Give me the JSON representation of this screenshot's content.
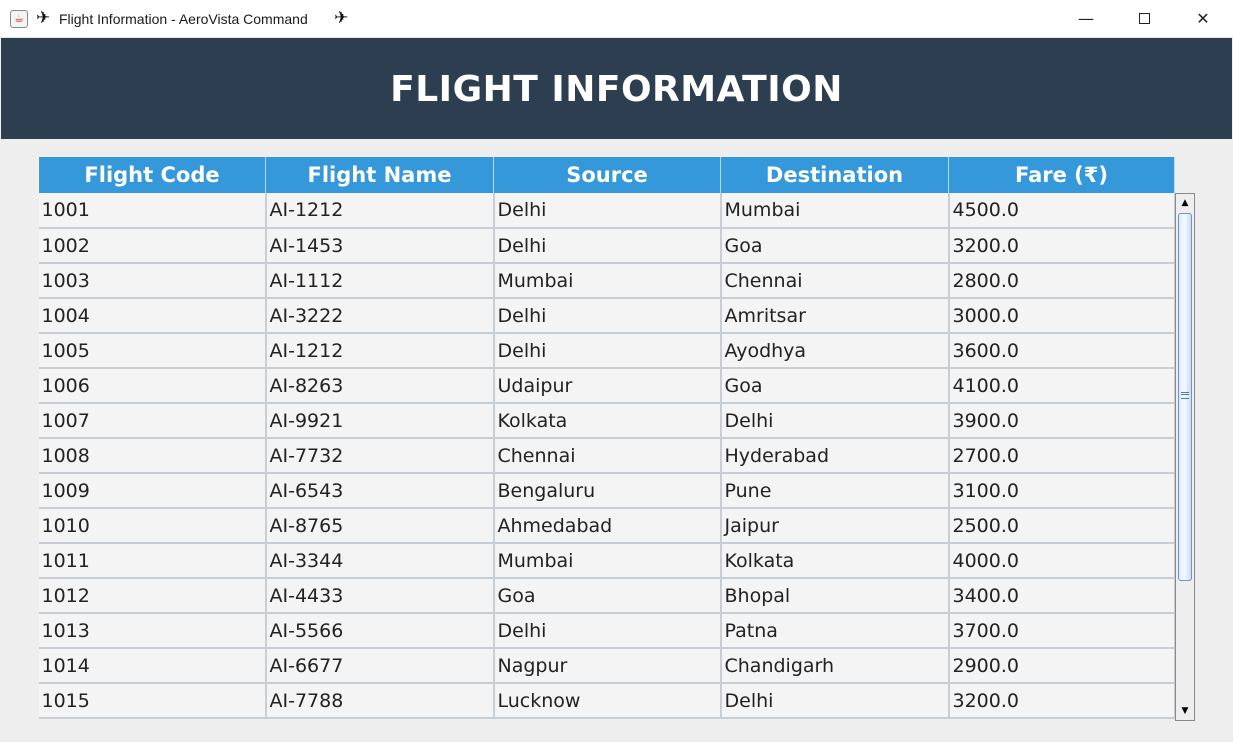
{
  "window": {
    "title": "Flight Information - AeroVista Command",
    "title_icon_left": "✈",
    "title_icon_right": "✈",
    "controls": {
      "minimize": "—",
      "close": "✕"
    }
  },
  "header": {
    "title": "FLIGHT INFORMATION"
  },
  "table": {
    "columns": [
      "Flight Code",
      "Flight Name",
      "Source",
      "Destination",
      "Fare (₹)"
    ],
    "rows": [
      [
        "1001",
        "AI-1212",
        "Delhi",
        "Mumbai",
        "4500.0"
      ],
      [
        "1002",
        "AI-1453",
        "Delhi",
        "Goa",
        "3200.0"
      ],
      [
        "1003",
        "AI-1112",
        "Mumbai",
        "Chennai",
        "2800.0"
      ],
      [
        "1004",
        "AI-3222",
        "Delhi",
        "Amritsar",
        "3000.0"
      ],
      [
        "1005",
        "AI-1212",
        "Delhi",
        "Ayodhya",
        "3600.0"
      ],
      [
        "1006",
        "AI-8263",
        "Udaipur",
        "Goa",
        "4100.0"
      ],
      [
        "1007",
        "AI-9921",
        "Kolkata",
        "Delhi",
        "3900.0"
      ],
      [
        "1008",
        "AI-7732",
        "Chennai",
        "Hyderabad",
        "2700.0"
      ],
      [
        "1009",
        "AI-6543",
        "Bengaluru",
        "Pune",
        "3100.0"
      ],
      [
        "1010",
        "AI-8765",
        "Ahmedabad",
        "Jaipur",
        "2500.0"
      ],
      [
        "1011",
        "AI-3344",
        "Mumbai",
        "Kolkata",
        "4000.0"
      ],
      [
        "1012",
        "AI-4433",
        "Goa",
        "Bhopal",
        "3400.0"
      ],
      [
        "1013",
        "AI-5566",
        "Delhi",
        "Patna",
        "3700.0"
      ],
      [
        "1014",
        "AI-6677",
        "Nagpur",
        "Chandigarh",
        "2900.0"
      ],
      [
        "1015",
        "AI-7788",
        "Lucknow",
        "Delhi",
        "3200.0"
      ]
    ]
  },
  "scrollbar": {
    "up_arrow": "▲",
    "down_arrow": "▼",
    "position_fraction": 0.0
  },
  "colors": {
    "header_banner": "#2c3e50",
    "table_header": "#3498db",
    "row_background": "#f4f4f4",
    "grid_line": "#c7ced6"
  }
}
